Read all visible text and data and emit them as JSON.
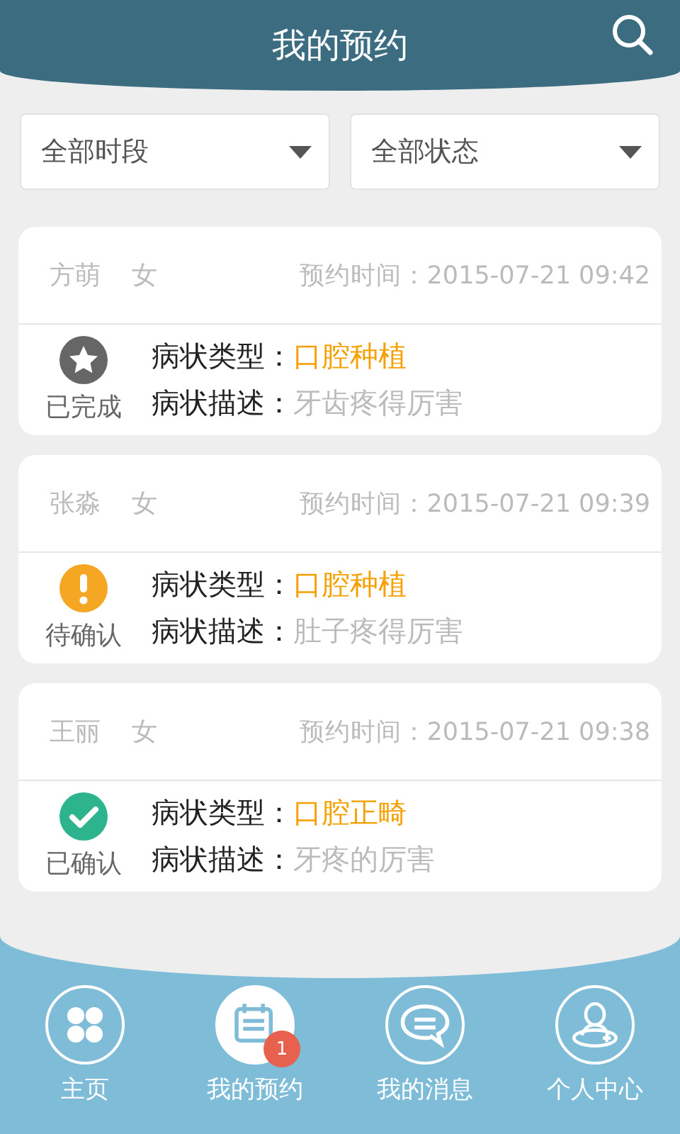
{
  "header": {
    "title": "我的预约"
  },
  "filters": [
    {
      "label": "全部时段"
    },
    {
      "label": "全部状态"
    }
  ],
  "appointments": [
    {
      "name": "方萌",
      "gender": "女",
      "time": "预约时间：2015-07-21 09:42",
      "kind": "completed",
      "status": "已完成",
      "type_label": "病状类型：",
      "type_value": "口腔种植",
      "desc_label": "病状描述：",
      "desc_value": "牙齿疼得厉害"
    },
    {
      "name": "张淼",
      "gender": "女",
      "time": "预约时间：2015-07-21 09:39",
      "kind": "pending",
      "status": "待确认",
      "type_label": "病状类型：",
      "type_value": "口腔种植",
      "desc_label": "病状描述：",
      "desc_value": "肚子疼得厉害"
    },
    {
      "name": "王丽",
      "gender": "女",
      "time": "预约时间：2015-07-21 09:38",
      "kind": "confirmed",
      "status": "已确认",
      "type_label": "病状类型：",
      "type_value": "口腔正畸",
      "desc_label": "病状描述：",
      "desc_value": "牙疼的厉害"
    }
  ],
  "nav": [
    {
      "kind": "home",
      "label": "主页",
      "selected": false
    },
    {
      "kind": "appointments",
      "label": "我的预约",
      "selected": true,
      "badge": "1"
    },
    {
      "kind": "messages",
      "label": "我的消息",
      "selected": false
    },
    {
      "kind": "profile",
      "label": "个人中心",
      "selected": false
    }
  ]
}
